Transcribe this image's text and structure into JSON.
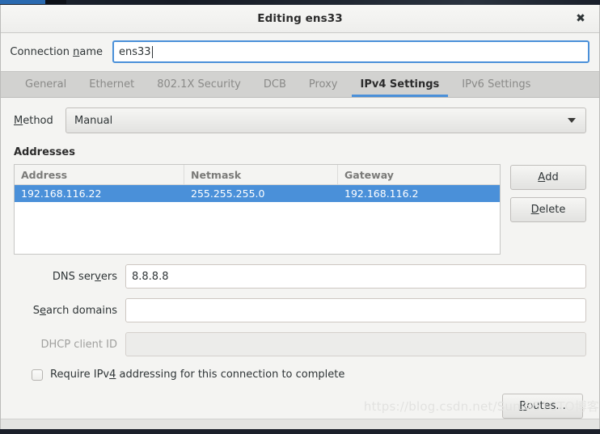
{
  "window": {
    "title": "Editing ens33",
    "close_icon": "close-icon"
  },
  "connection": {
    "label_pre": "Connection ",
    "label_mnemonic": "n",
    "label_post": "ame",
    "value": "ens33"
  },
  "tabs": [
    {
      "label": "General",
      "active": false
    },
    {
      "label": "Ethernet",
      "active": false
    },
    {
      "label": "802.1X Security",
      "active": false
    },
    {
      "label": "DCB",
      "active": false
    },
    {
      "label": "Proxy",
      "active": false
    },
    {
      "label": "IPv4 Settings",
      "active": true
    },
    {
      "label": "IPv6 Settings",
      "active": false
    }
  ],
  "method": {
    "label_mnemonic": "M",
    "label_post": "ethod",
    "value": "Manual",
    "arrow_icon": "chevron-down-icon"
  },
  "addresses": {
    "section_title": "Addresses",
    "columns": [
      "Address",
      "Netmask",
      "Gateway"
    ],
    "rows": [
      {
        "address": "192.168.116.22",
        "netmask": "255.255.255.0",
        "gateway": "192.168.116.2",
        "selected": true
      }
    ],
    "add_mnemonic": "A",
    "add_post": "dd",
    "delete_mnemonic": "D",
    "delete_post": "elete"
  },
  "fields": {
    "dns": {
      "label_pre": "DNS ser",
      "label_mnemonic": "v",
      "label_post": "ers",
      "value": "8.8.8.8",
      "disabled": false
    },
    "search": {
      "label_pre": "S",
      "label_mnemonic": "e",
      "label_post": "arch domains",
      "value": "",
      "disabled": false
    },
    "dhcp": {
      "label_pre": "DHCP client ID",
      "label_mnemonic": "",
      "label_post": "",
      "value": "",
      "disabled": true
    }
  },
  "require_ipv4": {
    "checked": false,
    "label_pre": "Require IPv",
    "label_mnemonic": "4",
    "label_post": " addressing for this connection to complete"
  },
  "routes": {
    "mnemonic": "R",
    "post": "outes..."
  },
  "watermark": {
    "text_1": "https://blog.csdn.net/Sun",
    "text_2": "@51CTO博客"
  },
  "colors": {
    "selection_blue": "#4a90d9",
    "tab_accent": "#4a90d9",
    "window_bg": "#f4f4f2",
    "tabbar_bg": "#d2d2d0"
  }
}
